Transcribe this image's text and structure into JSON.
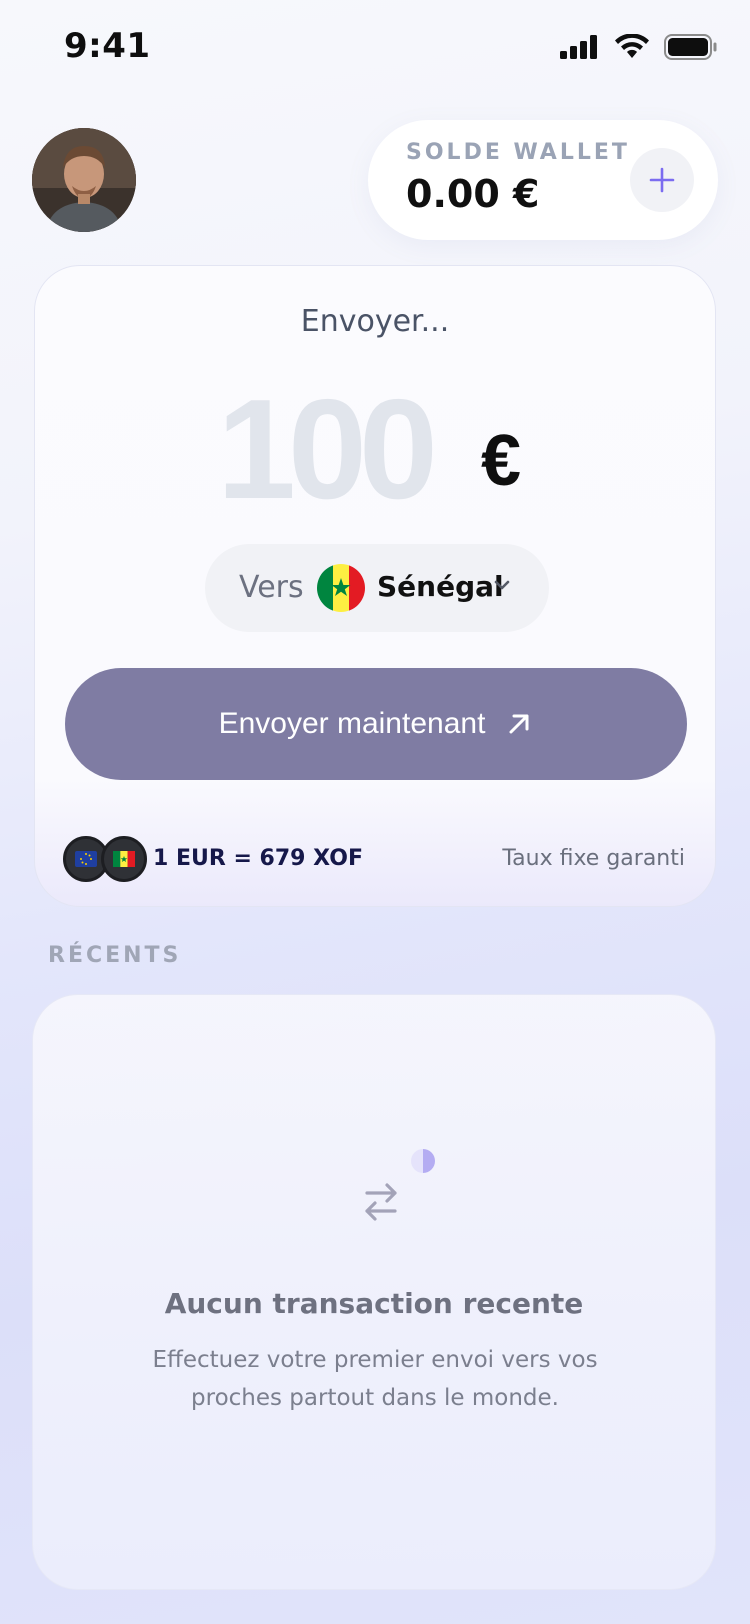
{
  "status_bar": {
    "time": "9:41",
    "icons": [
      "signal-icon",
      "wifi-icon",
      "battery-icon"
    ]
  },
  "header": {
    "avatar": "avatar",
    "wallet": {
      "label": "SOLDE WALLET",
      "amount": "0.00 €",
      "add_icon": "plus-icon"
    }
  },
  "send": {
    "title": "Envoyer...",
    "amount": "100",
    "currency": "€",
    "country_prefix": "Vers",
    "country": "Sénégal",
    "country_flag": "senegal-flag-icon",
    "button_label": "Envoyer maintenant",
    "button_icon": "arrow-up-right-icon",
    "rate": "1 EUR = 679 XOF",
    "rate_note": "Taux fixe garanti",
    "rate_flags": [
      "eu-flag-icon",
      "senegal-flag-icon"
    ]
  },
  "recents": {
    "label": "RÉCENTS",
    "empty_icon": "transfer-arrows-icon",
    "empty_title": "Aucun transaction recente",
    "empty_description": "Effectuez votre premier envoi vers vos proches partout dans le monde."
  },
  "colors": {
    "accent": "#7b6cf0",
    "button": "#7f7ca3",
    "senegal_green": "#00853f",
    "senegal_yellow": "#fdef42",
    "senegal_red": "#e31b23"
  }
}
